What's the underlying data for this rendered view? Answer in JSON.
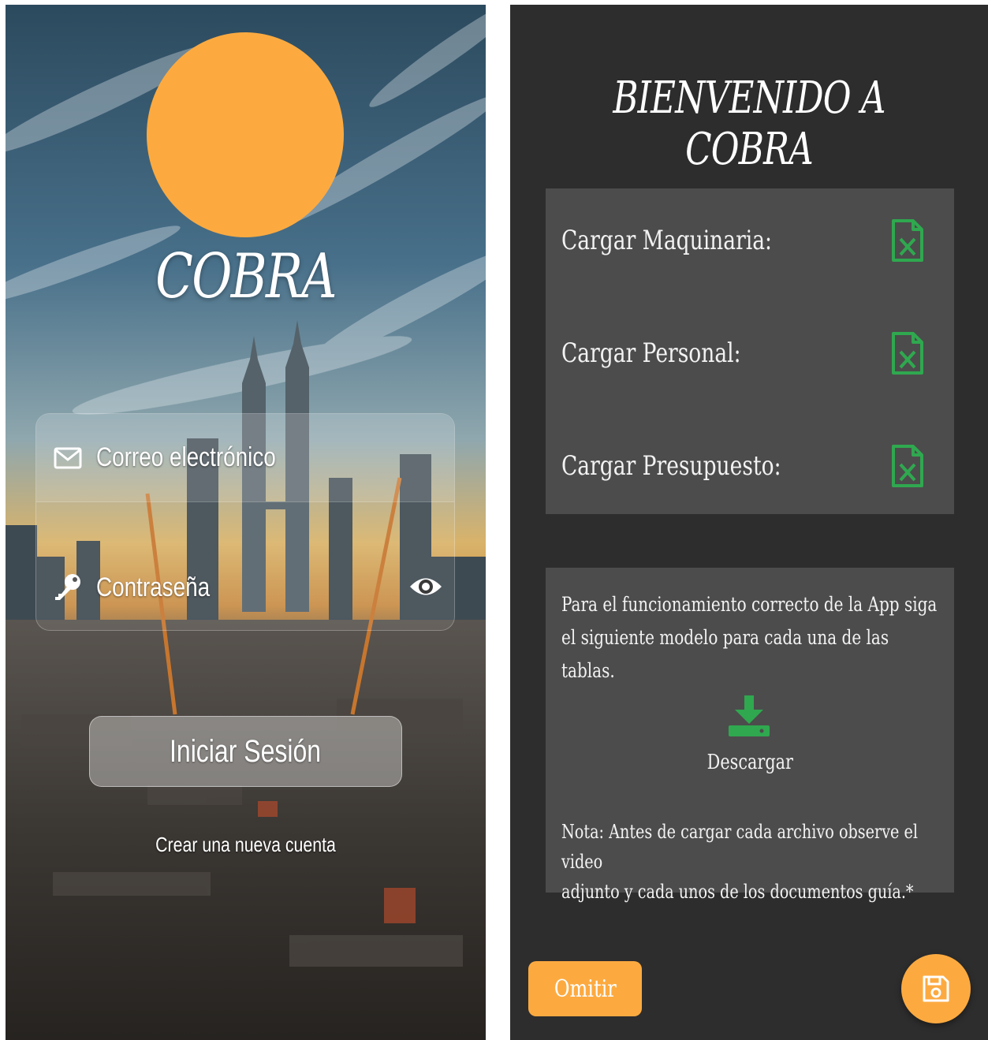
{
  "colors": {
    "accent_orange": "#fcaa40",
    "dark_background": "#2d2d2d",
    "card_background": "#4c4c4c",
    "excel_green": "#2fa84f"
  },
  "login": {
    "brand": "COBRA",
    "email_placeholder": "Correo electrónico",
    "password_placeholder": "Contraseña",
    "login_button": "Iniciar Sesión",
    "create_account_link": "Crear una nueva cuenta",
    "icons": [
      "envelope-icon",
      "key-icon",
      "eye-icon"
    ]
  },
  "welcome": {
    "title": "BIENVENIDO A COBRA",
    "uploads": [
      {
        "label": "Cargar Maquinaria:",
        "icon": "excel-file-icon"
      },
      {
        "label": "Cargar Personal:",
        "icon": "excel-file-icon"
      },
      {
        "label": "Cargar Presupuesto:",
        "icon": "excel-file-icon"
      }
    ],
    "info_line1": "Para el funcionamiento correcto de la App siga",
    "info_line2": "el siguiente modelo para cada una de las tablas.",
    "download_label": "Descargar",
    "note_line1": "Nota: Antes de cargar cada archivo observe el video",
    "note_line2": "adjunto y cada unos de los documentos guía.*",
    "omit_button": "Omitir",
    "save_icon": "floppy-disk-icon"
  }
}
